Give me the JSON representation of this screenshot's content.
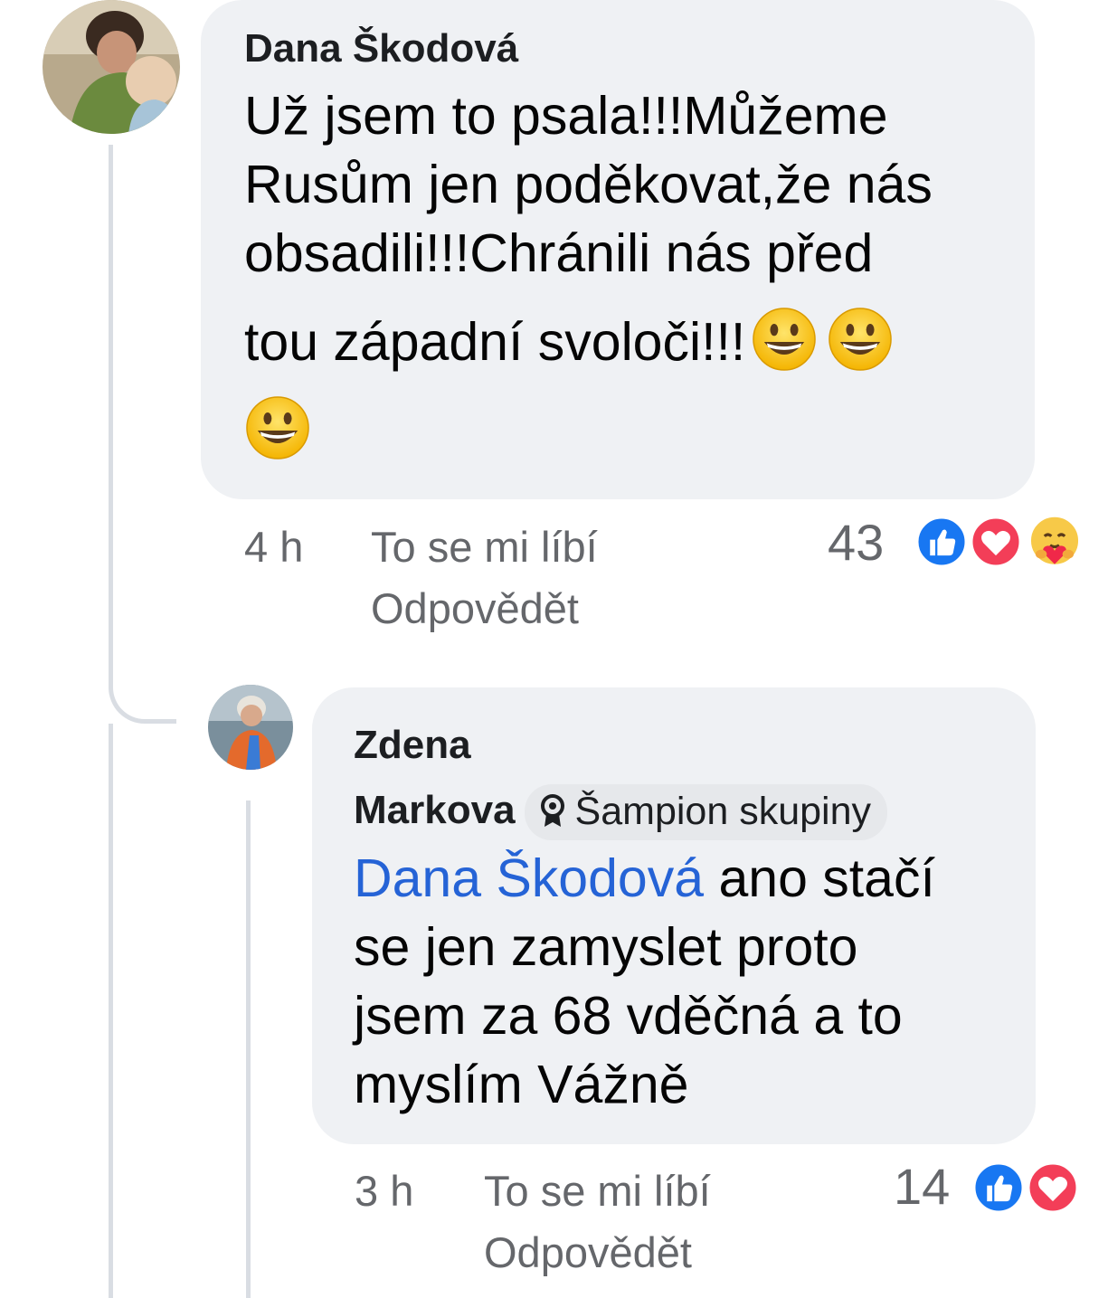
{
  "comments": [
    {
      "author": "Dana Škodová",
      "text_lines": [
        "Už jsem to psala!!!Můžeme",
        "Rusům jen poděkovat,že nás",
        "obsadili!!!Chránili nás před",
        "tou západní svoloči!!!"
      ],
      "emoji": "grinning-face",
      "time": "4 h",
      "like_label": "To se mi líbí",
      "reply_label": "Odpovědět",
      "reaction_count": "43",
      "reactions": [
        "like-icon",
        "love-icon",
        "care-icon"
      ]
    },
    {
      "author_line1": "Zdena",
      "author_line2": "Markova",
      "badge": "Šampion skupiny",
      "mention": "Dana Škodová",
      "text_first": " ano stačí",
      "text_lines": [
        "se jen zamyslet proto",
        "jsem za 68 vděčná a to",
        "myslím Vážně"
      ],
      "time": "3 h",
      "like_label": "To se mi líbí",
      "reply_label": "Odpovědět",
      "reaction_count": "14",
      "reactions": [
        "like-icon",
        "love-icon"
      ]
    }
  ],
  "colors": {
    "bubble": "#eff1f4",
    "mention": "#2563d6",
    "like": "#1877f2",
    "love": "#f33e58",
    "meta": "#65676b"
  }
}
